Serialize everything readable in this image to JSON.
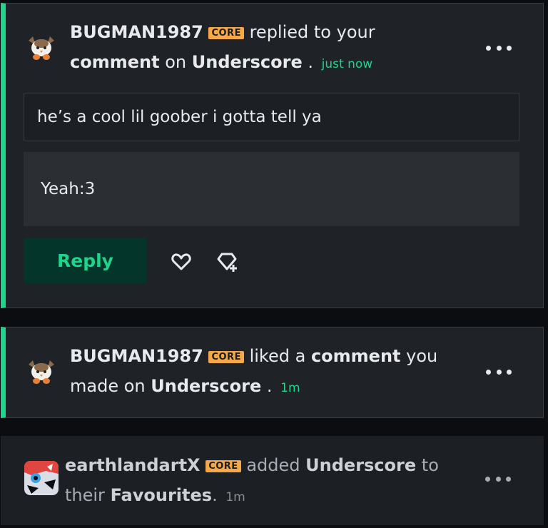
{
  "notifications": [
    {
      "user": "BUGMAN1987",
      "badge": "CORE",
      "action_pre": "replied to your",
      "object": "comment",
      "connector": "on",
      "target": "Underscore",
      "end": ".",
      "time": "just now",
      "quoted_comment": "he’s a cool lil goober i gotta tell ya",
      "reply_text": "Yeah:3",
      "reply_button": "Reply",
      "like_icon": "heart-icon",
      "gift_icon": "gem-plus-icon",
      "menu_icon": "more-horizontal-icon"
    },
    {
      "user": "BUGMAN1987",
      "badge": "CORE",
      "action_pre": "liked a",
      "object": "comment",
      "action_post": "you made on",
      "target": "Underscore",
      "end": ".",
      "time": "1m",
      "menu_icon": "more-horizontal-icon"
    },
    {
      "user": "earthlandartX",
      "badge": "CORE",
      "action_pre": "added",
      "target": "Underscore",
      "connector": "to their",
      "object": "Favourites",
      "end": ".",
      "time": "1m",
      "menu_icon": "more-horizontal-icon"
    }
  ],
  "colors": {
    "accent": "#1fd48d",
    "badge": "#f5a84a",
    "card_bg": "#1f2226",
    "page_bg": "#0b0d10"
  }
}
